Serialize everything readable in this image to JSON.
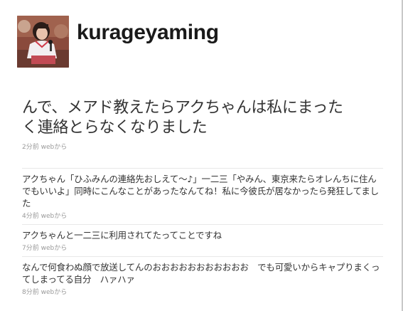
{
  "profile": {
    "username": "kurageyaming",
    "avatar_icon": "profile-photo"
  },
  "main_status": {
    "text": "んで、メアド教えたらアクちゃんは私にまったく連絡とらなくなりました",
    "time": "2分前",
    "source": "webから"
  },
  "updates": [
    {
      "text": "アクちゃん「ひふみんの連絡先おしえて～♪」一二三「やみん、東京来たらオレんちに住んでもいいよ」同時にこんなことがあったなんてね！私に今彼氏が居なかったら発狂してました",
      "time": "4分前",
      "source": "webから"
    },
    {
      "text": "アクちゃんと一二三に利用されてたってことですね",
      "time": "7分前",
      "source": "webから"
    },
    {
      "text": "なんで何食わぬ顔で放送してんのおおおおおおおおおおお　でも可愛いからキャプりまくってしまってる自分　ハァハァ",
      "time": "8分前",
      "source": "webから"
    }
  ],
  "colors": {
    "text": "#333333",
    "meta": "#999999",
    "divider": "#e8e8e8"
  }
}
